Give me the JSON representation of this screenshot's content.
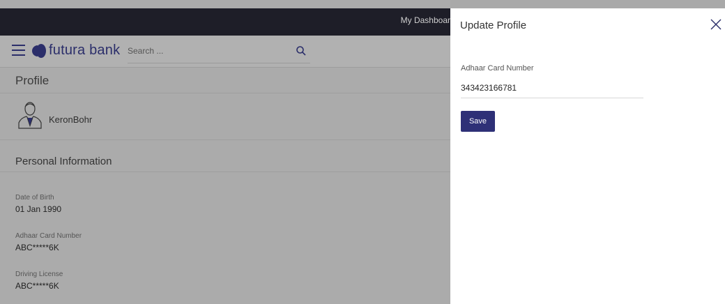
{
  "topbar": {
    "dashboard_label": "My Dashboar"
  },
  "header": {
    "logo_text": "futura bank",
    "search_placeholder": "Search ..."
  },
  "profile": {
    "page_title": "Profile",
    "username": "KeronBohr",
    "section_title": "Personal Information",
    "fields": [
      {
        "label": "Date of Birth",
        "value": "01 Jan 1990"
      },
      {
        "label": "Adhaar Card Number",
        "value": "ABC*****6K"
      },
      {
        "label": "Driving License",
        "value": "ABC*****6K"
      }
    ]
  },
  "panel": {
    "title": "Update Profile",
    "field_label": "Adhaar Card Number",
    "field_value": "343423166781",
    "save_label": "Save"
  },
  "colors": {
    "brand": "#2b2e6a",
    "button": "#2e3077",
    "overlay": "#ababab"
  },
  "icons": [
    "hamburger-menu-icon",
    "futura-logo-icon",
    "search-icon",
    "user-avatar-icon",
    "close-icon"
  ]
}
